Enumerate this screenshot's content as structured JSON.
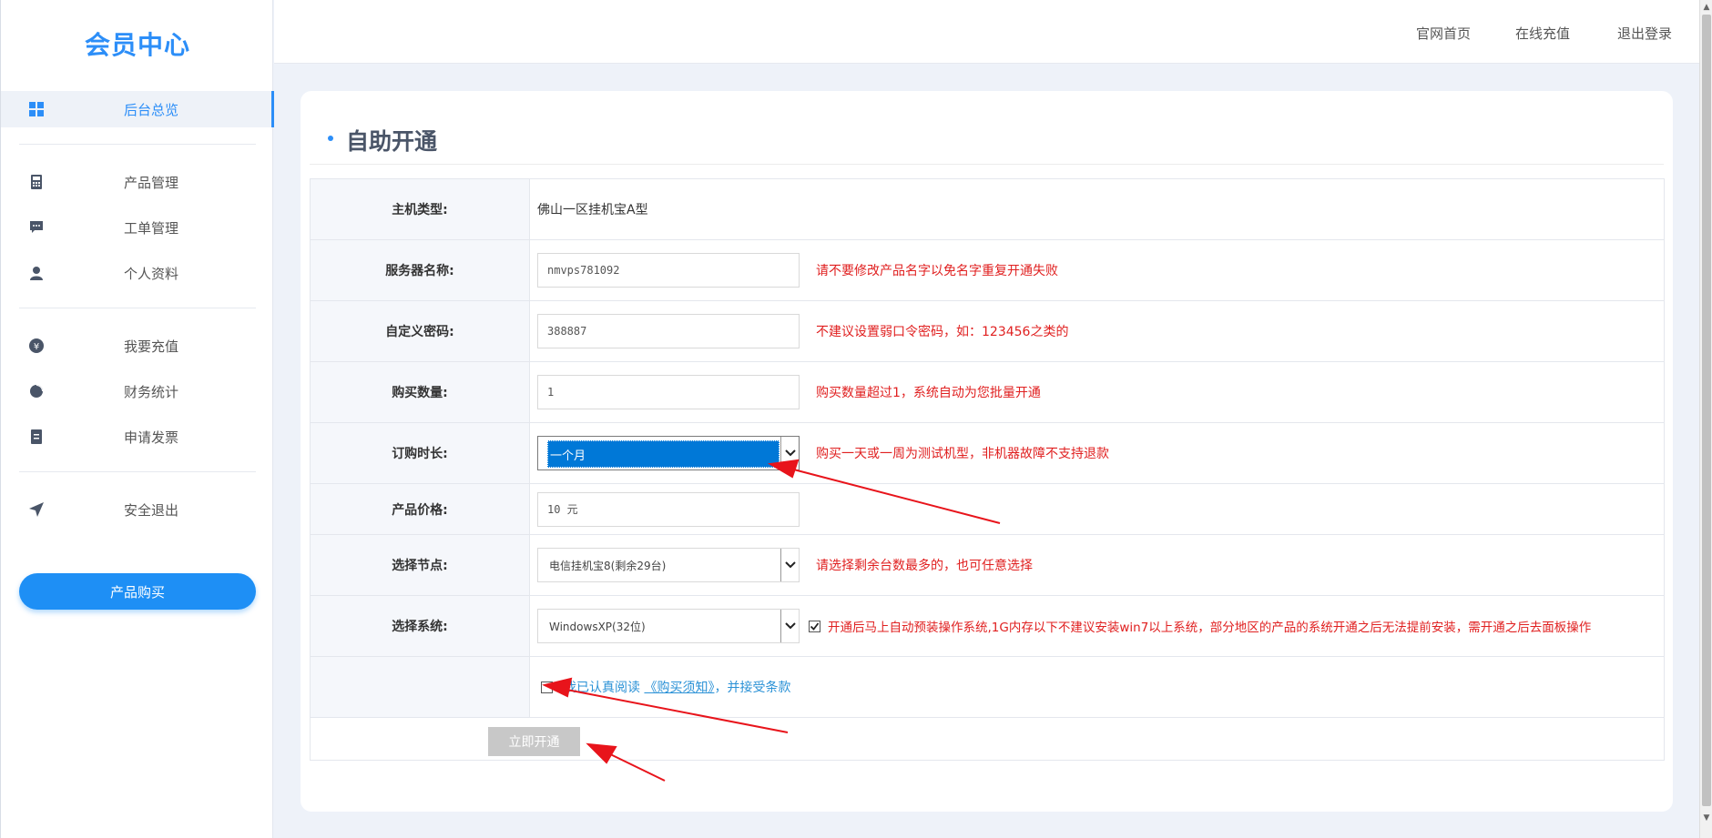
{
  "sidebar": {
    "logo": "会员中心",
    "items": [
      {
        "label": "后台总览",
        "icon": "dashboard-icon"
      },
      {
        "label": "产品管理",
        "icon": "calculator-icon"
      },
      {
        "label": "工单管理",
        "icon": "message-icon"
      },
      {
        "label": "个人资料",
        "icon": "user-icon"
      },
      {
        "label": "我要充值",
        "icon": "yen-icon"
      },
      {
        "label": "财务统计",
        "icon": "pie-chart-icon"
      },
      {
        "label": "申请发票",
        "icon": "invoice-icon"
      },
      {
        "label": "安全退出",
        "icon": "send-icon"
      }
    ],
    "buy_button": "产品购买"
  },
  "header": {
    "links": [
      "官网首页",
      "在线充值",
      "退出登录"
    ]
  },
  "page": {
    "title": "自助开通"
  },
  "form": {
    "host_type": {
      "label": "主机类型:",
      "value": "佛山一区挂机宝A型"
    },
    "server_name": {
      "label": "服务器名称:",
      "value": "nmvps781092",
      "hint": "请不要修改产品名字以免名字重复开通失败"
    },
    "password": {
      "label": "自定义密码:",
      "value": "388887",
      "hint": "不建议设置弱口令密码，如：123456之类的"
    },
    "quantity": {
      "label": "购买数量:",
      "value": "1",
      "hint": "购买数量超过1，系统自动为您批量开通"
    },
    "duration": {
      "label": "订购时长:",
      "value": "一个月",
      "hint": "购买一天或一周为测试机型，非机器故障不支持退款"
    },
    "price": {
      "label": "产品价格:",
      "value": "10 元"
    },
    "node": {
      "label": "选择节点:",
      "value": "电信挂机宝8(剩余29台)",
      "hint": "请选择剩余台数最多的，也可任意选择"
    },
    "system": {
      "label": "选择系统:",
      "value": "WindowsXP(32位)",
      "note": "开通后马上自动预装操作系统,1G内存以下不建议安装win7以上系统，部分地区的产品的系统开通之后无法提前安装，需开通之后去面板操作"
    },
    "agreement": {
      "prefix": "我已认真阅读",
      "link": "《购买须知》",
      "suffix": "，并接受条款"
    },
    "submit": "立即开通"
  },
  "colors": {
    "accent": "#2c8ef8",
    "warning_text": "#e02020",
    "annotation_arrow": "#e8141b"
  }
}
